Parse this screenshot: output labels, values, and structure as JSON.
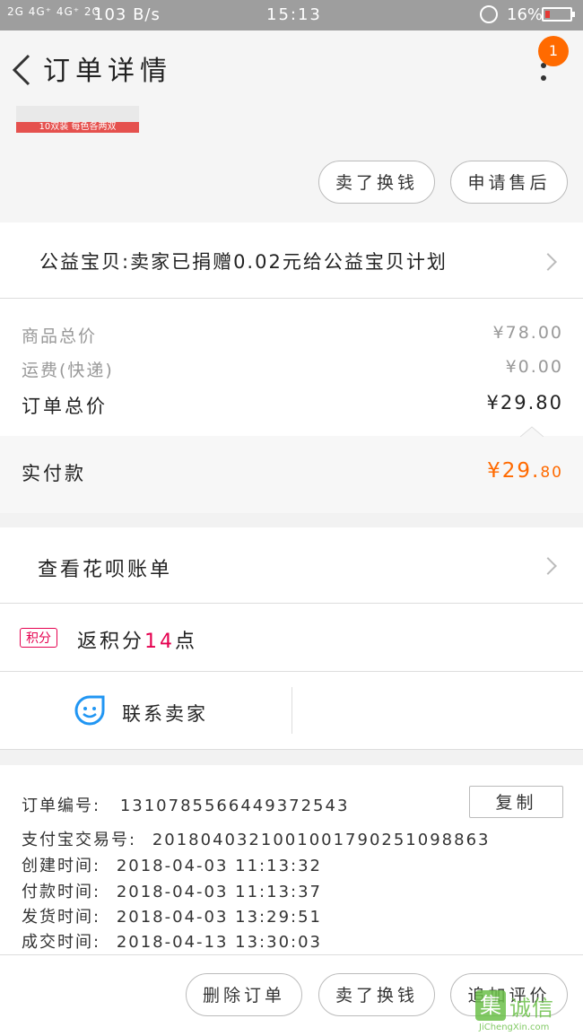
{
  "status_bar": {
    "signal": "2G 4G⁺ 4G⁺ 2G",
    "net_speed": "103 B/s",
    "time": "15:13",
    "battery": "16%"
  },
  "header": {
    "title": "订单详情",
    "badge": "1",
    "thumb_caption": "10双装 每色各两双",
    "btn_exchange": "卖了换钱",
    "btn_after_sale": "申请售后"
  },
  "charity": {
    "text": "公益宝贝:卖家已捐赠0.02元给公益宝贝计划"
  },
  "price": {
    "goods_label": "商品总价",
    "goods_value": "¥78.00",
    "shipping_label": "运费(快递)",
    "shipping_value": "¥0.00",
    "total_label": "订单总价",
    "total_value": "¥29.80",
    "paid_label": "实付款",
    "paid_value_main": "¥29.",
    "paid_value_dec": "80"
  },
  "huabei": {
    "label": "查看花呗账单"
  },
  "points": {
    "tag": "积分",
    "prefix": "返积分",
    "amount": "14",
    "suffix": "点"
  },
  "contact": {
    "label": "联系卖家"
  },
  "order_info": {
    "order_no_label": "订单编号:",
    "order_no": "1310785566449372543",
    "copy_label": "复制",
    "alipay_label": "支付宝交易号:",
    "alipay_no": "2018040321001001790251098863",
    "created_label": "创建时间:",
    "created": "2018-04-03 11:13:32",
    "paid_label": "付款时间:",
    "paid": "2018-04-03 11:13:37",
    "shipped_label": "发货时间:",
    "shipped": "2018-04-03 13:29:51",
    "done_label": "成交时间:",
    "done": "2018-04-13 13:30:03"
  },
  "bottom_bar": {
    "delete_label": "删除订单",
    "exchange_label": "卖了换钱",
    "review_label": "追加评价"
  },
  "watermark": {
    "text": "集诚信",
    "url_text": "JiChengXin.com"
  },
  "colors": {
    "accent": "#ff6a00",
    "points_red": "#e5004f",
    "contact_blue": "#2196f3"
  }
}
